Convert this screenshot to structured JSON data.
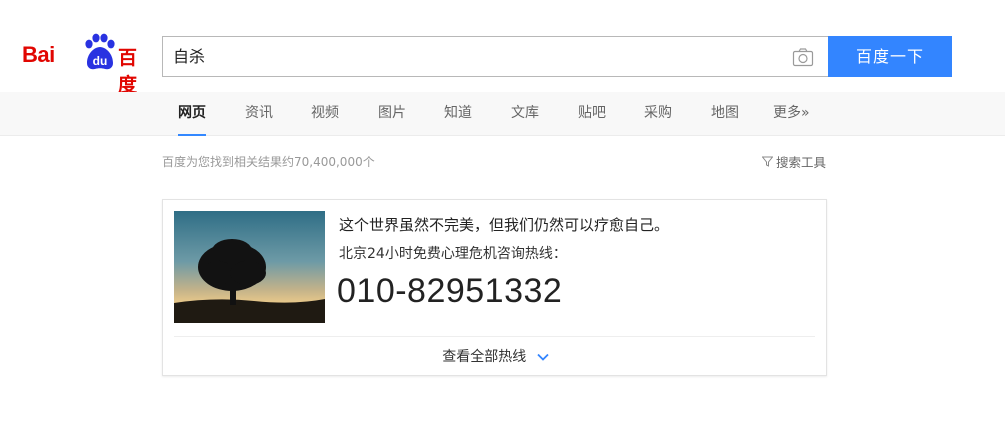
{
  "logo": {
    "latin": "Bai",
    "paw_text": "du",
    "chinese": "百度"
  },
  "search": {
    "query": "自杀",
    "button_label": "百度一下"
  },
  "tabs": [
    {
      "label": "网页",
      "active": true
    },
    {
      "label": "资讯",
      "active": false
    },
    {
      "label": "视频",
      "active": false
    },
    {
      "label": "图片",
      "active": false
    },
    {
      "label": "知道",
      "active": false
    },
    {
      "label": "文库",
      "active": false
    },
    {
      "label": "贴吧",
      "active": false
    },
    {
      "label": "采购",
      "active": false
    },
    {
      "label": "地图",
      "active": false
    },
    {
      "label": "更多»",
      "active": false
    }
  ],
  "results": {
    "count_text": "百度为您找到相关结果约70,400,000个",
    "tools_label": "搜索工具"
  },
  "card": {
    "line1": "这个世界虽然不完美，但我们仍然可以疗愈自己。",
    "line2": "北京24小时免费心理危机咨询热线：",
    "phone": "010-82951332",
    "more_label": "查看全部热线"
  },
  "colors": {
    "brand_red": "#e10601",
    "brand_blue": "#2932e1",
    "button_blue": "#3385ff",
    "tab_underline": "#3388ff"
  },
  "icons": {
    "camera": "camera-icon",
    "funnel": "funnel-icon",
    "chevron": "chevron-down-icon"
  }
}
